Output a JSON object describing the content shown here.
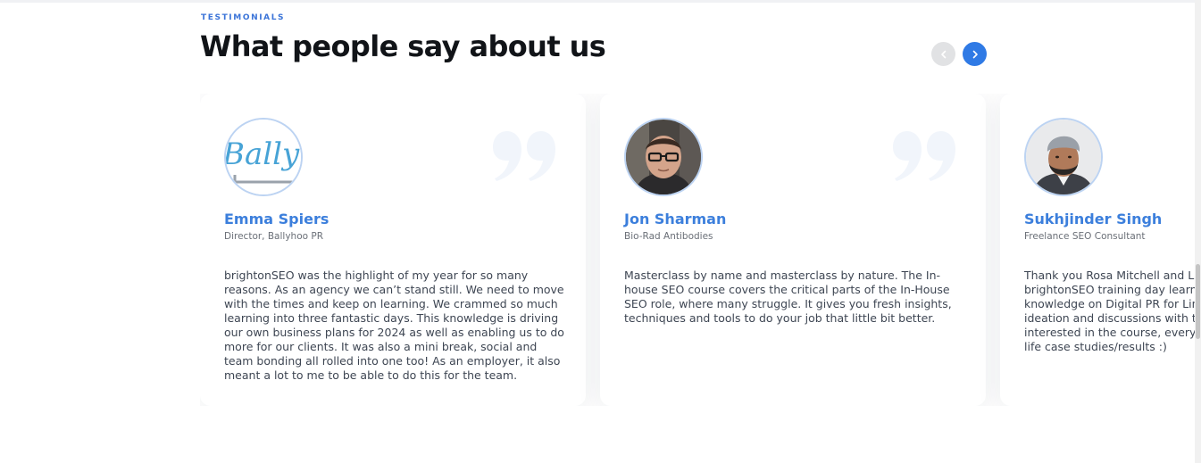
{
  "section": {
    "eyebrow": "TESTIMONIALS",
    "title": "What people say about us"
  },
  "nav": {
    "prev_icon": "chevron-left-icon",
    "next_icon": "chevron-right-icon",
    "prev_color": "#e1e2e4",
    "next_color": "#2f7ae5"
  },
  "colors": {
    "accent": "#2f7ae5",
    "name": "#3c7fdc",
    "heading": "#111418",
    "body": "#3e4653"
  },
  "testimonials": [
    {
      "name": "Emma Spiers",
      "role": "Director, Ballyhoo PR",
      "avatar_logo_text": "Ballyhoo",
      "quote": "brightonSEO was the highlight of my year for so many reasons. As an agency we can’t stand still. We need to move with the times and keep on learning. We crammed so much learning into three fantastic days. This knowledge is driving our own business plans for 2024 as well as enabling us to do more for our clients. It was also a mini break, social and team bonding all rolled into one too! As an employer, it also meant a lot to me to be able to do this for the team."
    },
    {
      "name": "Jon Sharman",
      "role": "Bio-Rad Antibodies",
      "quote": "Masterclass by name and masterclass by nature. The In-house SEO course covers the critical parts of the In-House SEO role, where many struggle. It gives you fresh insights, techniques and tools to do your job that little bit better."
    },
    {
      "name": "Sukhjinder Singh",
      "role": "Freelance SEO Consultant",
      "quote_lines": [
        "Thank you Rosa Mitchell and Lib",
        "brightonSEO training day learnin",
        "knowledge on Digital PR for Link",
        "ideation and discussions with th",
        "interested in the course, every s",
        "life case studies/results :)"
      ]
    }
  ]
}
